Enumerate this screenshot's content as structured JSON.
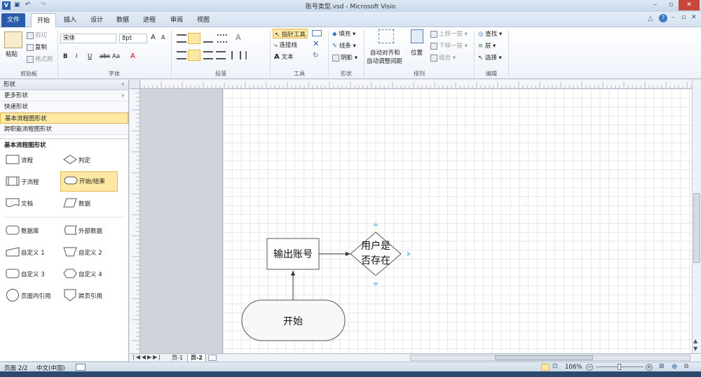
{
  "window": {
    "title": "账号类型.vsd - Microsoft Visio"
  },
  "tabs": [
    {
      "label": "文件"
    },
    {
      "label": "开始"
    },
    {
      "label": "插入"
    },
    {
      "label": "设计"
    },
    {
      "label": "数据"
    },
    {
      "label": "进程"
    },
    {
      "label": "审阅"
    },
    {
      "label": "视图"
    }
  ],
  "ribbon": {
    "clipboard": {
      "paste": "粘贴",
      "cut": "剪切",
      "copy": "复制",
      "format_painter": "格式刷",
      "group": "剪贴板"
    },
    "font": {
      "name": "宋体",
      "size": "8pt",
      "group": "字体",
      "bold": "B",
      "italic": "I",
      "underline": "U",
      "strike": "abc",
      "case": "Aa",
      "grow": "A",
      "shrink": "A",
      "color": "A"
    },
    "paragraph": {
      "group": "段落"
    },
    "tools": {
      "pointer": "指针工具",
      "connector": "连接线",
      "text": "文本",
      "group": "工具"
    },
    "shape": {
      "fill": "填充",
      "line": "线条",
      "shadow": "阴影",
      "group": "形状"
    },
    "arrange": {
      "auto_align": "自动对齐和",
      "auto_space": "自动调整间距",
      "position": "位置",
      "bring_forward": "上移一层",
      "send_backward": "下移一层",
      "group_btn": "组合",
      "group": "排列"
    },
    "editing": {
      "find": "查找",
      "layer": "层",
      "select": "选择",
      "group": "编辑"
    }
  },
  "shapes_panel": {
    "header": "形状",
    "rows": [
      "更多形状",
      "快速形状",
      "基本流程图形状",
      "跨职能流程图形状"
    ],
    "stencil_title": "基本流程图形状",
    "items": [
      {
        "label": "流程"
      },
      {
        "label": "判定"
      },
      {
        "label": "子流程"
      },
      {
        "label": "开始/结束"
      },
      {
        "label": "文档"
      },
      {
        "label": "数据"
      },
      {
        "label": "数据库"
      },
      {
        "label": "外部数据"
      },
      {
        "label": "自定义 1"
      },
      {
        "label": "自定义 2"
      },
      {
        "label": "自定义 3"
      },
      {
        "label": "自定义 4"
      },
      {
        "label": "页面内引用"
      },
      {
        "label": "跨页引用"
      }
    ]
  },
  "diagram": {
    "process_text": "输出账号",
    "decision_line1": "用户是",
    "decision_line2": "否存在",
    "start_text": "开始"
  },
  "page_tabs": {
    "p1": "页-1",
    "p2": "页-2"
  },
  "status": {
    "page": "页面 2/2",
    "lang": "中文(中国)",
    "zoom": "106%"
  }
}
